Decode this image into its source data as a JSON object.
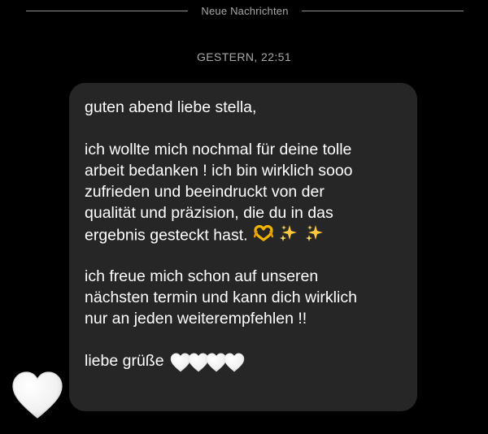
{
  "divider": {
    "label": "Neue Nachrichten"
  },
  "timestamp": "GESTERN, 22:51",
  "message": {
    "line1": "guten abend liebe stella,",
    "line2": "ich wollte mich nochmal für deine tolle",
    "line3": "arbeit bedanken ! ich bin wirklich sooo",
    "line4": "zufrieden und beeindruckt von der",
    "line5": "qualität und präzision, die du in das",
    "line6": "ergebnis gesteckt hast.",
    "line7": "ich freue mich schon auf unseren",
    "line8": "nächsten termin und kann dich wirklich",
    "line9": "nur an jeden weiterempfehlen !!",
    "line10": "liebe grüße",
    "emojis_after_line6": [
      "heart-hands-emoji",
      "sparkles-emoji",
      "sparkles-emoji"
    ],
    "hearts_after_line10": [
      "white-heart-emoji",
      "white-heart-emoji",
      "white-heart-emoji",
      "white-heart-emoji"
    ]
  },
  "reaction": {
    "icon": "white-heart-emoji"
  },
  "colors": {
    "background": "#000000",
    "bubble": "#262626",
    "meta_text": "#a8a8a8",
    "message_text": "#ffffff"
  }
}
